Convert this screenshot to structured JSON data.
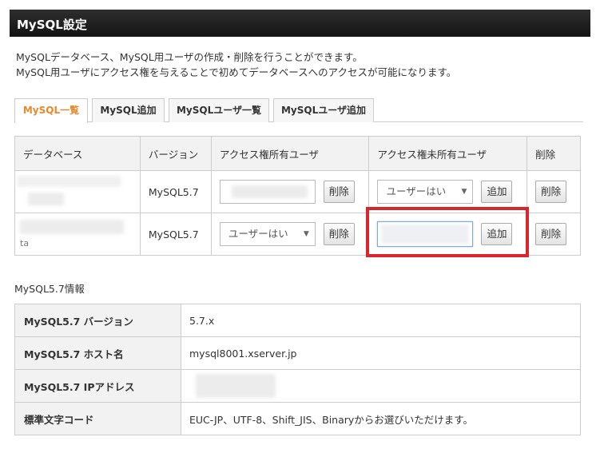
{
  "header": {
    "title": "MySQL設定"
  },
  "intro": {
    "line1": "MySQLデータベース、MySQL用ユーザの作成・削除を行うことができます。",
    "line2": "MySQL用ユーザにアクセス権を与えることで初めてデータベースへのアクセスが可能になります。"
  },
  "tabs": [
    {
      "label": "MySQL一覧",
      "active": true
    },
    {
      "label": "MySQL追加",
      "active": false
    },
    {
      "label": "MySQLユーザ一覧",
      "active": false
    },
    {
      "label": "MySQLユーザ追加",
      "active": false
    }
  ],
  "db_table": {
    "headers": [
      "データベース",
      "バージョン",
      "アクセス権所有ユーザ",
      "アクセス権未所有ユーザ",
      "削除"
    ],
    "rows": [
      {
        "version": "MySQL5.7",
        "owner_delete_label": "削除",
        "non_owner_select": "ユーザーはい",
        "add_label": "追加",
        "delete_label": "削除"
      },
      {
        "db_suffix": "ta",
        "version": "MySQL5.7",
        "owner_select": "ユーザーはい",
        "owner_delete_label": "削除",
        "add_label": "追加",
        "delete_label": "削除"
      }
    ]
  },
  "info": {
    "title": "MySQL5.7情報",
    "rows": [
      {
        "label": "MySQL5.7 バージョン",
        "value": "5.7.x"
      },
      {
        "label": "MySQL5.7 ホスト名",
        "value": "mysql8001.xserver.jp"
      },
      {
        "label": "MySQL5.7 IPアドレス",
        "value": ""
      },
      {
        "label": "標準文字コード",
        "value": "EUC-JP、UTF-8、Shift_JIS、Binaryからお選びいただけます。"
      }
    ]
  },
  "colors": {
    "active_tab": "#e8892b",
    "highlight": "#d8262d",
    "header_bg": "#1e1e1e"
  }
}
